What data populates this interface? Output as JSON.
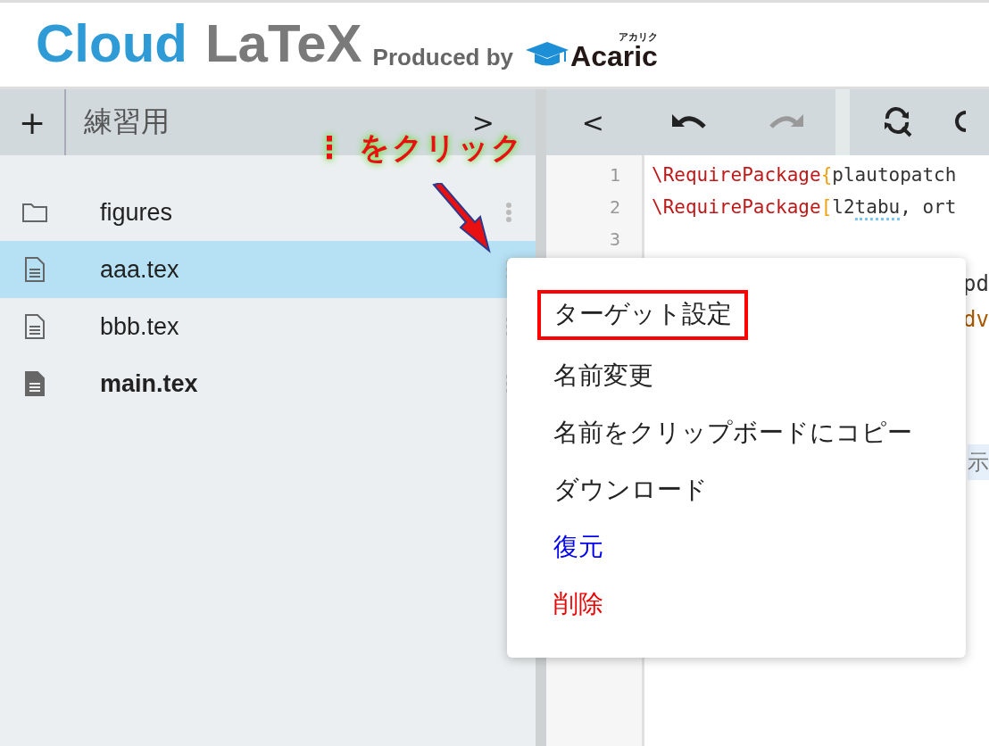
{
  "header": {
    "logo_primary": "Cloud",
    "logo_secondary": "LaTeX",
    "produced_by": "Produced by",
    "brand": "Acaric",
    "brand_kana": "アカリク"
  },
  "file_panel": {
    "add_label": "+",
    "project_title": "練習用",
    "forward_label": ">",
    "files": [
      {
        "name": "figures",
        "kind": "folder",
        "selected": false,
        "target": false
      },
      {
        "name": "aaa.tex",
        "kind": "file",
        "selected": true,
        "target": false
      },
      {
        "name": "bbb.tex",
        "kind": "file",
        "selected": false,
        "target": false
      },
      {
        "name": "main.tex",
        "kind": "file",
        "selected": false,
        "target": true
      }
    ]
  },
  "editor_toolbar": {
    "back_label": "<",
    "undo_disabled": false,
    "redo_disabled": true
  },
  "editor": {
    "lines": [
      {
        "number": "1",
        "segments": [
          {
            "text": "\\RequirePackage",
            "kind": "command"
          },
          {
            "text": "{",
            "kind": "bracket"
          },
          {
            "text": "plautopatch",
            "kind": "plain"
          }
        ]
      },
      {
        "number": "2",
        "segments": [
          {
            "text": "\\RequirePackage",
            "kind": "command"
          },
          {
            "text": "[",
            "kind": "bracket"
          },
          {
            "text": "l2",
            "kind": "plain"
          },
          {
            "text": "tabu",
            "kind": "misspelled"
          },
          {
            "text": ", ort",
            "kind": "plain"
          }
        ]
      },
      {
        "number": "3"
      }
    ],
    "fragments": [
      {
        "text": "pd",
        "kind": "plain"
      },
      {
        "text": "dv",
        "kind": "keyword"
      },
      {
        "text": "示",
        "kind": "highlighted"
      }
    ]
  },
  "annotation": {
    "text": "⋮ をクリック"
  },
  "context_menu": {
    "items": [
      {
        "label": "ターゲット設定",
        "color": "#222222",
        "boxed": true
      },
      {
        "label": "名前変更",
        "color": "#222222",
        "boxed": false
      },
      {
        "label": "名前をクリップボードにコピー",
        "color": "#222222",
        "boxed": false
      },
      {
        "label": "ダウンロード",
        "color": "#222222",
        "boxed": false
      },
      {
        "label": "復元",
        "color": "#0000ee",
        "boxed": false
      },
      {
        "label": "削除",
        "color": "#ee0000",
        "boxed": false
      }
    ]
  }
}
